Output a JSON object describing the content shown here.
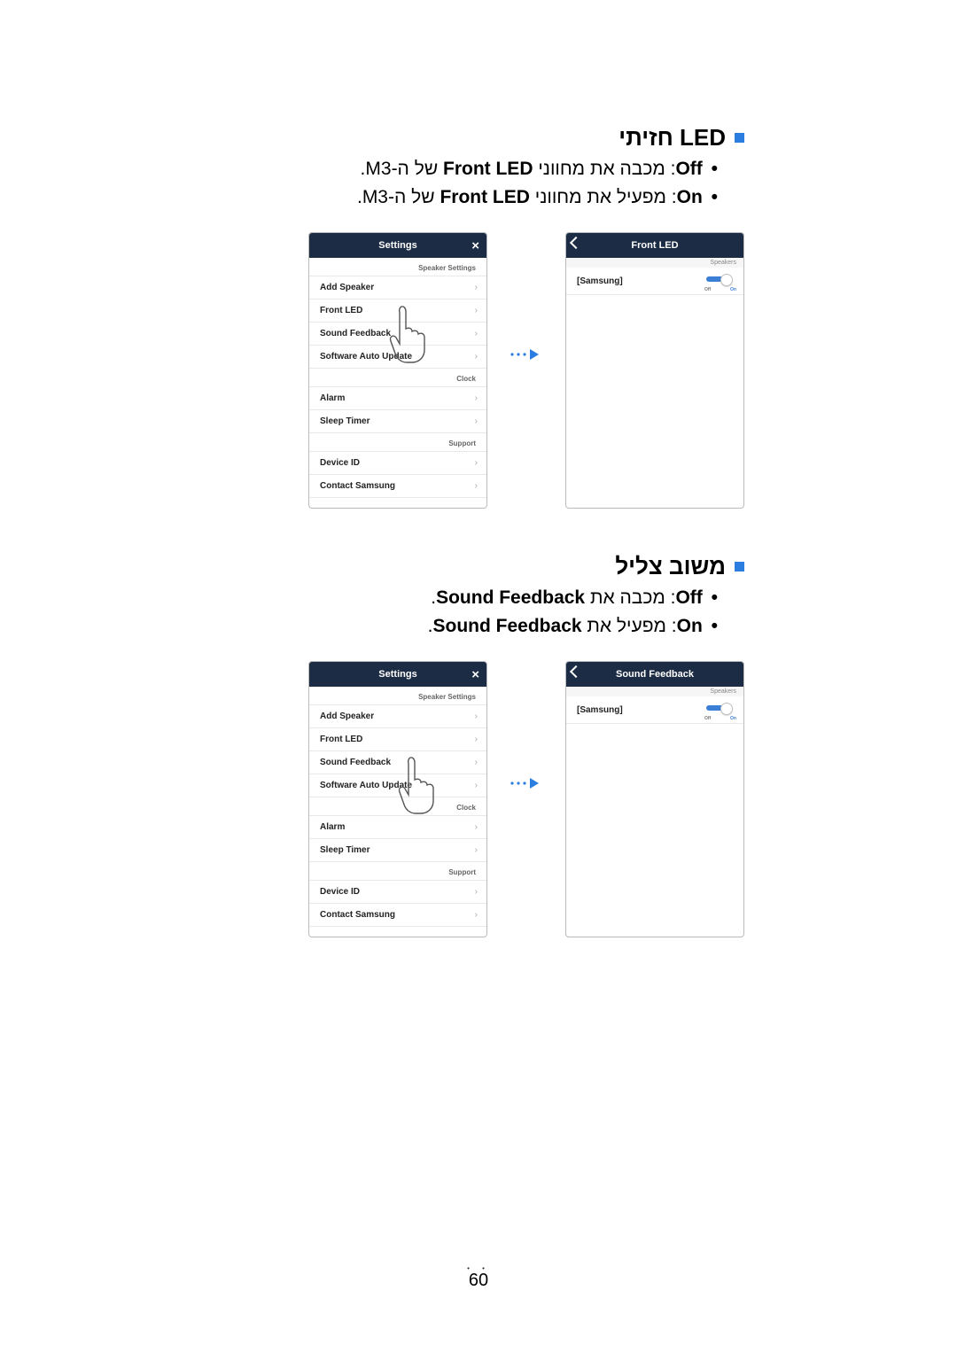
{
  "section1": {
    "title": "LED חזיתי",
    "items": [
      {
        "label": "Off",
        "text": ": מכבה את מחווני ",
        "strong": "Front LED",
        "tail": " של ה-M3."
      },
      {
        "label": "On",
        "text": ": מפעיל את מחווני ",
        "strong": "Front LED",
        "tail": " של ה-M3."
      }
    ]
  },
  "section2": {
    "title": "משוב צליל",
    "items": [
      {
        "label": "Off",
        "text": ": מכבה את ",
        "strong": "Sound Feedback",
        "tail": "."
      },
      {
        "label": "On",
        "text": ": מפעיל את ",
        "strong": "Sound Feedback",
        "tail": "."
      }
    ]
  },
  "settingsPanel": {
    "title": "Settings",
    "groups": {
      "speaker": {
        "header": "Speaker Settings",
        "items": [
          "Add Speaker",
          "Front LED",
          "Sound Feedback",
          "Software Auto Update"
        ]
      },
      "clock": {
        "header": "Clock",
        "items": [
          "Alarm",
          "Sleep Timer"
        ]
      },
      "support": {
        "header": "Support",
        "items": [
          "Device ID",
          "Contact Samsung"
        ]
      }
    }
  },
  "detailPanel1": {
    "title": "Front LED",
    "sub": "Speakers",
    "device": "[Samsung]",
    "offLabel": "Off",
    "onLabel": "On"
  },
  "detailPanel2": {
    "title": "Sound Feedback",
    "sub": "Speakers",
    "device": "[Samsung]",
    "offLabel": "Off",
    "onLabel": "On"
  },
  "pageNumber": "60"
}
